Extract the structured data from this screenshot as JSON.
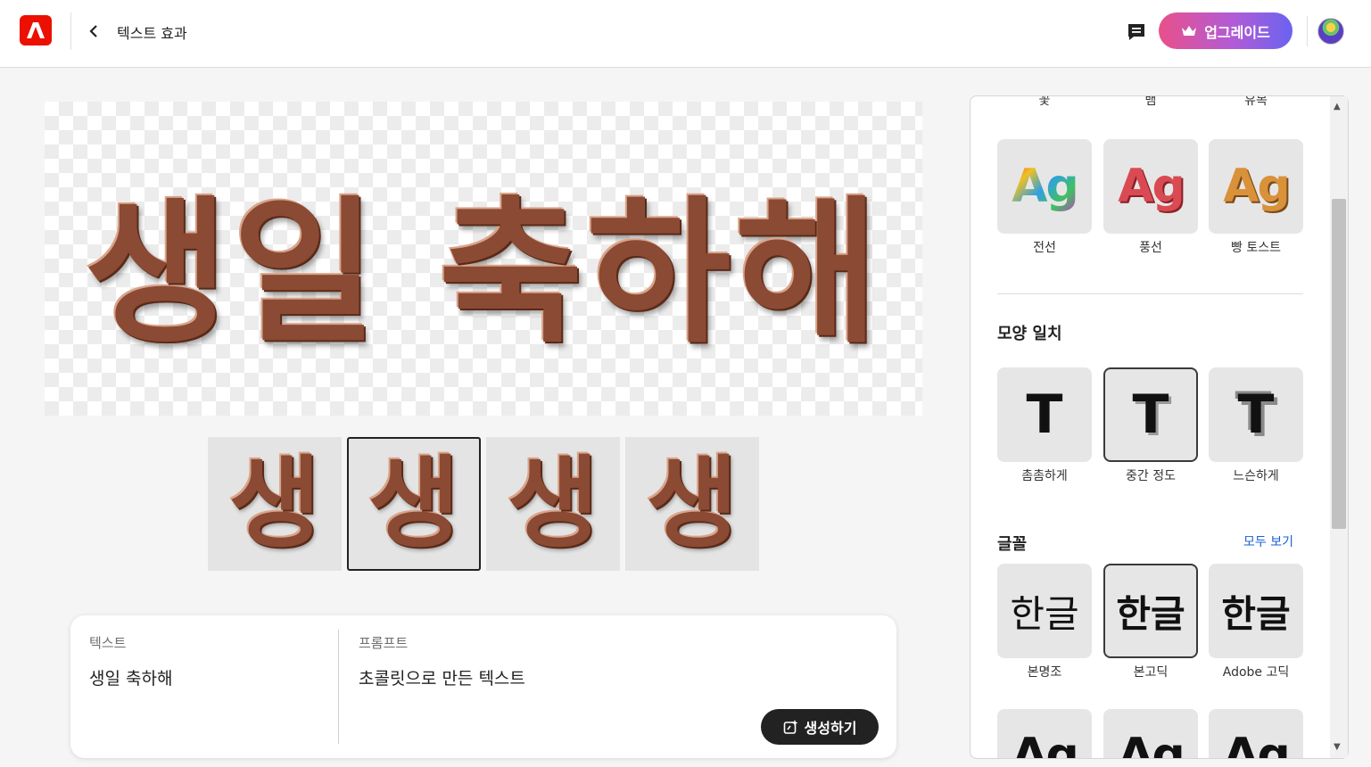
{
  "header": {
    "title": "텍스트 효과",
    "upgrade_label": "업그레이드"
  },
  "preview": {
    "text": "생일 축하해"
  },
  "thumbnails": [
    {
      "text": "생"
    },
    {
      "text": "생"
    },
    {
      "text": "생"
    },
    {
      "text": "생"
    }
  ],
  "input": {
    "text_label": "텍스트",
    "text_value": "생일 축하해",
    "prompt_label": "프롬프트",
    "prompt_value": "초콜릿으로 만든 텍스트",
    "generate_label": "생성하기"
  },
  "panel": {
    "clipped_labels": [
      "꽃",
      "뱀",
      "유목"
    ],
    "effects": [
      {
        "sample": "Ag",
        "label": "전선"
      },
      {
        "sample": "Ag",
        "label": "풍선"
      },
      {
        "sample": "Ag",
        "label": "빵 토스트"
      }
    ],
    "shape_title": "모양 일치",
    "shapes": [
      {
        "sample": "T",
        "label": "촘촘하게"
      },
      {
        "sample": "T",
        "label": "중간 정도"
      },
      {
        "sample": "T",
        "label": "느슨하게"
      }
    ],
    "font_title": "글꼴",
    "see_all": "모두 보기",
    "fonts": [
      {
        "sample": "한글",
        "label": "본명조"
      },
      {
        "sample": "한글",
        "label": "본고딕"
      },
      {
        "sample": "한글",
        "label": "Adobe 고딕"
      }
    ],
    "bottom_samples": [
      "Ag",
      "Ag",
      "Ag"
    ]
  },
  "colors": {
    "brand": "#eb1000",
    "upgrade_gradient_start": "#e9508a",
    "upgrade_gradient_end": "#6a63f0",
    "link": "#1a5fd6"
  }
}
